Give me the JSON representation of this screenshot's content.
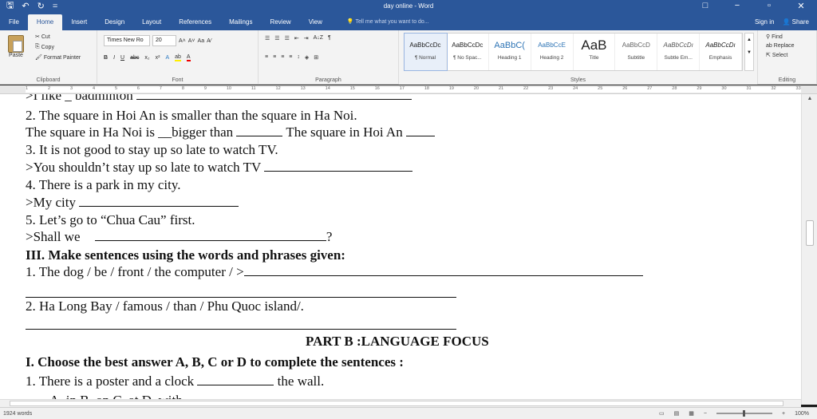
{
  "window": {
    "title": "day online - Word",
    "controls": {
      "restore": "□",
      "minimize": "−",
      "maximize": "▫",
      "close": "✕"
    }
  },
  "quick_access": {
    "save_icon": "save-icon",
    "undo_icon": "undo-icon",
    "redo_icon": "redo-icon",
    "customize": "="
  },
  "tabs": [
    "File",
    "Home",
    "Insert",
    "Design",
    "Layout",
    "References",
    "Mailings",
    "Review",
    "View"
  ],
  "active_tab": "Home",
  "tell_me": "Tell me what you want to do...",
  "account": {
    "sign_in": "Sign in",
    "share": "Share"
  },
  "ribbon": {
    "clipboard": {
      "paste": "Paste",
      "cut": "Cut",
      "copy": "Copy",
      "format_painter": "Format Painter",
      "label": "Clipboard"
    },
    "font": {
      "name": "Times New Ro",
      "size": "20",
      "grow": "A˄",
      "shrink": "A˅",
      "case": "Aa",
      "clear": "A⁄",
      "bold": "B",
      "italic": "I",
      "underline": "U",
      "strike": "abc",
      "sub": "x₂",
      "sup": "x²",
      "effects": "A",
      "highlight": "ab",
      "color": "A",
      "label": "Font"
    },
    "paragraph": {
      "bullets": "☰",
      "numbering": "☰",
      "multilevel": "☰",
      "dec_indent": "⇤",
      "inc_indent": "⇥",
      "sort": "A↓Z",
      "pilcrow": "¶",
      "align_left": "≡",
      "center": "≡",
      "align_right": "≡",
      "justify": "≡",
      "line_spacing": "↕",
      "shading": "◈",
      "borders": "⊞",
      "label": "Paragraph"
    },
    "styles": {
      "items": [
        {
          "preview": "AaBbCcDc",
          "name": "¶ Normal"
        },
        {
          "preview": "AaBbCcDc",
          "name": "¶ No Spac..."
        },
        {
          "preview": "AaBbC(",
          "name": "Heading 1"
        },
        {
          "preview": "AaBbCcE",
          "name": "Heading 2"
        },
        {
          "preview": "AaB",
          "name": "Title"
        },
        {
          "preview": "AaBbCcD",
          "name": "Subtitle"
        },
        {
          "preview": "AaBbCcDı",
          "name": "Subtle Em..."
        },
        {
          "preview": "AaBbCcDı",
          "name": "Emphasis"
        }
      ],
      "label": "Styles"
    },
    "editing": {
      "find": "Find",
      "replace": "Replace",
      "select": "Select",
      "label": "Editing"
    }
  },
  "ruler_numbers": [
    "1",
    "2",
    "3",
    "4",
    "5",
    "6",
    "7",
    "8",
    "9",
    "10",
    "11",
    "12",
    "13",
    "14",
    "15",
    "16",
    "17",
    "18",
    "19",
    "20",
    "21",
    "22",
    "23",
    "24",
    "25",
    "26",
    "27",
    "28",
    "29",
    "30",
    "31",
    "32",
    "33"
  ],
  "document": {
    "lines": [
      {
        "id": "l0",
        "text": ">I like _ badminton"
      },
      {
        "id": "l1",
        "text": "2. The square in Hoi An  is  smaller than the square in Ha Noi."
      },
      {
        "id": "l2a",
        "text": "The square in Ha Noi is __bigger than ",
        "b": " The square in Hoi An "
      },
      {
        "id": "l3",
        "text": "3. It is not good to stay up so late to watch TV."
      },
      {
        "id": "l4",
        "text": ">You shouldn’t stay up so late to watch TV "
      },
      {
        "id": "l5",
        "text": "4. There is a park in my city."
      },
      {
        "id": "l6",
        "text": ">My city "
      },
      {
        "id": "l7",
        "text": "5. Let’s go to “Chua Cau” first."
      },
      {
        "id": "l8",
        "text": " >Shall we ",
        "end": "?"
      },
      {
        "id": "l9",
        "text": "III. Make sentences using the words and phrases given:"
      },
      {
        "id": "l10",
        "text": "1.  The dog / be / front / the computer /  >"
      },
      {
        "id": "l11",
        "text": "2. Ha Long Bay / famous / than / Phu Quoc island/."
      },
      {
        "id": "l12",
        "text": "PART B :LANGUAGE FOCUS"
      },
      {
        "id": "l13",
        "text": "I. Choose the best answer A, B, C or D to complete the sentences :"
      },
      {
        "id": "l14",
        "text": "1.  There is a poster and a clock ",
        "end": " the wall."
      },
      {
        "id": "l15",
        "text": "A. in          B. on          C. at          D. with"
      }
    ]
  },
  "status": {
    "words": "1924 words",
    "zoom": "100%"
  }
}
